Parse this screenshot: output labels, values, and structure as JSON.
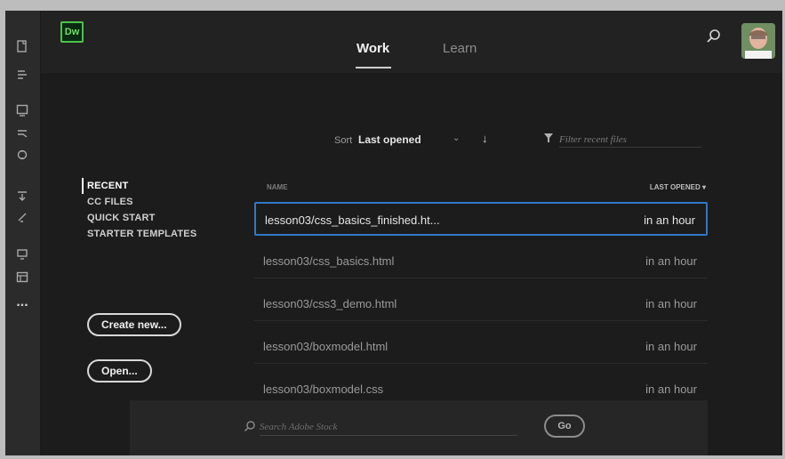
{
  "app": {
    "logo_text": "Dw",
    "accent_color": "#4fc04a",
    "selection_color": "#2f78c9"
  },
  "top_nav": {
    "tabs": [
      {
        "label": "Work",
        "active": true
      },
      {
        "label": "Learn",
        "active": false
      }
    ],
    "search_icon": "search-icon",
    "avatar": "user-avatar"
  },
  "toolbar": {
    "icons": [
      "new-file-icon",
      "insert-icon",
      "files-panel-icon",
      "css-panel-icon",
      "dom-icon",
      "code-collapse-icon",
      "wrap-tag-icon",
      "format-icon",
      "panels-icon",
      "more-icon"
    ],
    "more_label": "..."
  },
  "sort": {
    "label": "Sort",
    "value": "Last opened",
    "caret": "⌄",
    "direction_arrow": "↓"
  },
  "filter": {
    "placeholder": "Filter recent files"
  },
  "leftnav": {
    "items": [
      {
        "label": "RECENT",
        "active": true
      },
      {
        "label": "CC FILES",
        "active": false
      },
      {
        "label": "QUICK START",
        "active": false
      },
      {
        "label": "STARTER TEMPLATES",
        "active": false
      }
    ]
  },
  "buttons": {
    "create_new": "Create new...",
    "open": "Open..."
  },
  "file_list": {
    "header_name": "NAME",
    "header_opened": "LAST OPENED ▾",
    "rows": [
      {
        "name": "lesson03/css_basics_finished.ht...",
        "time": "in an hour",
        "selected": true
      },
      {
        "name": "lesson03/css_basics.html",
        "time": "in an hour",
        "selected": false
      },
      {
        "name": "lesson03/css3_demo.html",
        "time": "in an hour",
        "selected": false
      },
      {
        "name": "lesson03/boxmodel.html",
        "time": "in an hour",
        "selected": false
      },
      {
        "name": "lesson03/boxmodel.css",
        "time": "in an hour",
        "selected": false
      }
    ]
  },
  "stock": {
    "placeholder": "Search Adobe Stock",
    "go_label": "Go"
  }
}
